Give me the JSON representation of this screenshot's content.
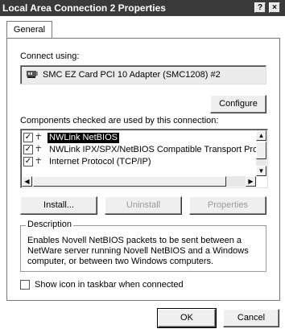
{
  "window": {
    "title": "Local Area Connection 2 Properties",
    "help_label": "?",
    "close_label": "×"
  },
  "tabs": [
    {
      "label": "General",
      "selected": true
    }
  ],
  "connect_using": {
    "label": "Connect using:",
    "adapter": "SMC EZ Card PCI 10 Adapter (SMC1208) #2",
    "configure_label": "Configure"
  },
  "components": {
    "label": "Components checked are used by this connection:",
    "items": [
      {
        "label": "NWLink NetBIOS",
        "checked": true,
        "selected": true
      },
      {
        "label": "NWLink IPX/SPX/NetBIOS Compatible Transport Proto",
        "checked": true,
        "selected": false
      },
      {
        "label": "Internet Protocol (TCP/IP)",
        "checked": true,
        "selected": false
      }
    ]
  },
  "buttons": {
    "install": "Install...",
    "uninstall": "Uninstall",
    "properties": "Properties",
    "ok": "OK",
    "cancel": "Cancel"
  },
  "description": {
    "title": "Description",
    "text": "Enables Novell NetBIOS packets to be sent between a NetWare server running Novell NetBIOS and a Windows computer, or between two Windows computers."
  },
  "taskbar_option": {
    "label": "Show icon in taskbar when connected",
    "checked": false
  }
}
